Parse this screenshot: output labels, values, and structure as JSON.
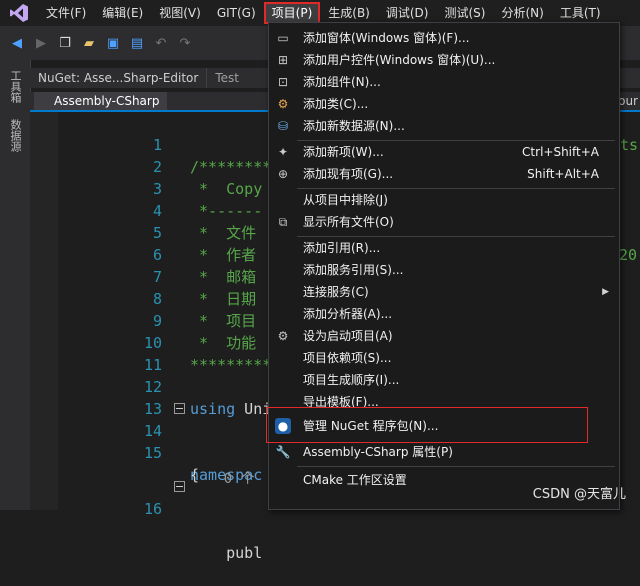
{
  "menubar": {
    "items": [
      "文件(F)",
      "编辑(E)",
      "视图(V)",
      "GIT(G)",
      "项目(P)",
      "生成(B)",
      "调试(D)",
      "测试(S)",
      "分析(N)",
      "工具(T)"
    ]
  },
  "sidebar": {
    "tabs": [
      "工具箱",
      "数据源"
    ]
  },
  "tabs": [
    "NuGet: Asse...Sharp-Editor",
    "Test"
  ],
  "file_tab": {
    "label": "Assembly-CSharp",
    "right_text": "our"
  },
  "code": {
    "lines": [
      {
        "num": "1",
        "text": "/*********"
      },
      {
        "num": "2",
        "text": " *  Copy"
      },
      {
        "num": "3",
        "text": " *------"
      },
      {
        "num": "4",
        "text": " *  文件"
      },
      {
        "num": "5",
        "text": " *  作者"
      },
      {
        "num": "6",
        "text": " *  邮箱"
      },
      {
        "num": "7",
        "text": " *  日期"
      },
      {
        "num": "8",
        "text": " *  项目"
      },
      {
        "num": "9",
        "text": " *  功能"
      },
      {
        "num": "10",
        "text": "*********"
      },
      {
        "num": "11",
        "text": ""
      },
      {
        "num": "12",
        "text_kw": "using",
        "text": " Uni"
      },
      {
        "num": "13",
        "text": ""
      },
      {
        "num": "14",
        "text_kw": "namespac",
        "text": ""
      },
      {
        "num": "15",
        "text": "{"
      },
      {
        "num": "",
        "text": "    0 个"
      },
      {
        "num": "16",
        "text": "    publ"
      }
    ],
    "right_fragments": {
      "line2": "ts",
      "line7": "/20"
    }
  },
  "dropdown": {
    "items": [
      {
        "icon": "add-form-icon",
        "label": "添加窗体(Windows 窗体)(F)...",
        "shortcut": ""
      },
      {
        "icon": "add-user-control-icon",
        "label": "添加用户控件(Windows 窗体)(U)...",
        "shortcut": ""
      },
      {
        "icon": "add-component-icon",
        "label": "添加组件(N)...",
        "shortcut": ""
      },
      {
        "icon": "add-class-icon",
        "label": "添加类(C)...",
        "shortcut": ""
      },
      {
        "icon": "add-datasource-icon",
        "label": "添加新数据源(N)...",
        "shortcut": ""
      },
      {
        "icon": "add-new-item-icon",
        "label": "添加新项(W)...",
        "shortcut": "Ctrl+Shift+A"
      },
      {
        "icon": "add-existing-item-icon",
        "label": "添加现有项(G)...",
        "shortcut": "Shift+Alt+A"
      },
      {
        "icon": "",
        "label": "从项目中排除(J)",
        "shortcut": ""
      },
      {
        "icon": "show-all-files-icon",
        "label": "显示所有文件(O)",
        "shortcut": ""
      },
      {
        "icon": "",
        "label": "添加引用(R)...",
        "shortcut": ""
      },
      {
        "icon": "",
        "label": "添加服务引用(S)...",
        "shortcut": ""
      },
      {
        "icon": "",
        "label": "连接服务(C)",
        "shortcut": "",
        "submenu": true
      },
      {
        "icon": "",
        "label": "添加分析器(A)...",
        "shortcut": ""
      },
      {
        "icon": "gear-icon",
        "label": "设为启动项目(A)",
        "shortcut": ""
      },
      {
        "icon": "",
        "label": "项目依赖项(S)...",
        "shortcut": ""
      },
      {
        "icon": "",
        "label": "项目生成顺序(I)...",
        "shortcut": ""
      },
      {
        "icon": "",
        "label": "导出模板(F)...",
        "shortcut": ""
      },
      {
        "icon": "nuget-icon",
        "label": "管理 NuGet 程序包(N)...",
        "shortcut": ""
      },
      {
        "icon": "wrench-icon",
        "label": "Assembly-CSharp 属性(P)",
        "shortcut": ""
      },
      {
        "icon": "",
        "label": "CMake 工作区设置",
        "shortcut": ""
      }
    ]
  },
  "watermark": "CSDN @天富儿",
  "colors": {
    "accent": "#007acc",
    "highlight": "#e02a2a",
    "comment": "#57a64a",
    "keyword": "#569cd6",
    "line_number": "#2b91af"
  }
}
